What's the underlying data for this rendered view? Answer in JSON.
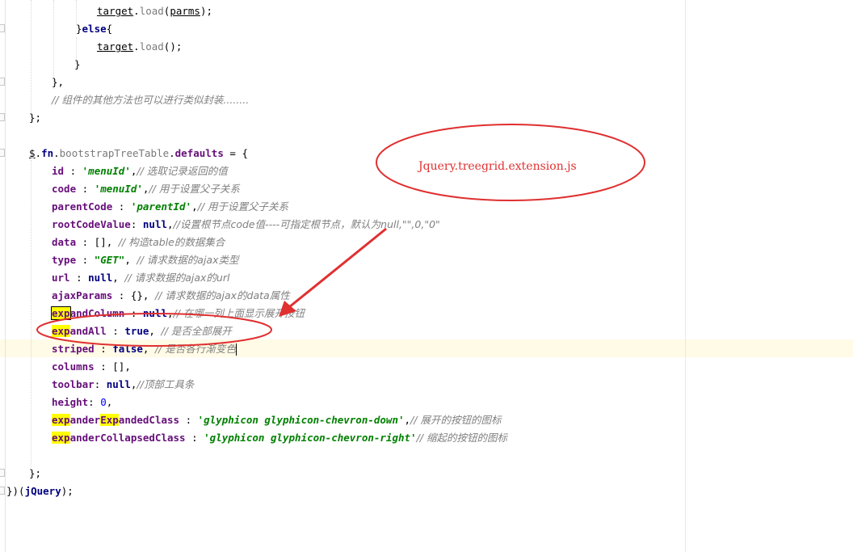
{
  "editor": {
    "lines": {
      "l1_obj": "target",
      "l1_call": "load",
      "l1_arg": "parms",
      "l2_else": "else",
      "l3_obj": "target",
      "l3_call": "load",
      "l6_comment": "// 组件的其他方法也可以进行类似封装........",
      "l8_fnname": "bootstrapTreeTable",
      "l8_defaults": "defaults",
      "id_key": "id",
      "id_val": "'menuId'",
      "id_comment": "// 选取记录返回的值",
      "code_key": "code",
      "code_val": "'menuId'",
      "code_comment": "// 用于设置父子关系",
      "parentCode_key": "parentCode",
      "parentCode_val": "'parentId'",
      "parentCode_comment": "// 用于设置父子关系",
      "rootCodeValue_key": "rootCodeValue",
      "rootCodeValue_val": "null",
      "rootCodeValue_comment": "//设置根节点code值----可指定根节点，默认为null,\"\",0,\"0\"",
      "data_key": "data",
      "data_comment": "// 构造table的数据集合",
      "type_key": "type",
      "type_val": "\"GET\"",
      "type_comment": "// 请求数据的ajax类型",
      "url_key": "url",
      "url_val": "null",
      "url_comment": "// 请求数据的ajax的url",
      "ajaxParams_key": "ajaxParams",
      "ajaxParams_comment": "// 请求数据的ajax的data属性",
      "expandColumn_hl": "exp",
      "expandColumn_rest": "andColumn",
      "expandColumn_val": "null",
      "expandColumn_comment": "// 在哪一列上面显示展开按钮",
      "expandAll_hl": "exp",
      "expandAll_rest": "andAll",
      "expandAll_val": "true",
      "expandAll_comment": "// 是否全部展开",
      "striped_key": "striped",
      "striped_val": "false",
      "striped_comment": "// 是否各行渐变色",
      "columns_key": "columns",
      "toolbar_key": "toolbar",
      "toolbar_val": "null",
      "toolbar_comment": "//顶部工具条",
      "height_key": "height",
      "height_val": "0",
      "eec_hl1": "exp",
      "eec_mid": "ander",
      "eec_hl2": "Exp",
      "eec_rest": "andedClass",
      "eec_val": "'glyphicon glyphicon-chevron-down'",
      "eec_comment": "// 展开的按钮的图标",
      "ecc_hl": "exp",
      "ecc_rest": "anderCollapsedClass",
      "ecc_val": "'glyphicon glyphicon-chevron-right'",
      "ecc_comment": "// 缩起的按钮的图标",
      "last_jquery": "jQuery"
    }
  },
  "annotation": {
    "label": "Jquery.treegrid.extension.js",
    "color": "#e03030"
  }
}
